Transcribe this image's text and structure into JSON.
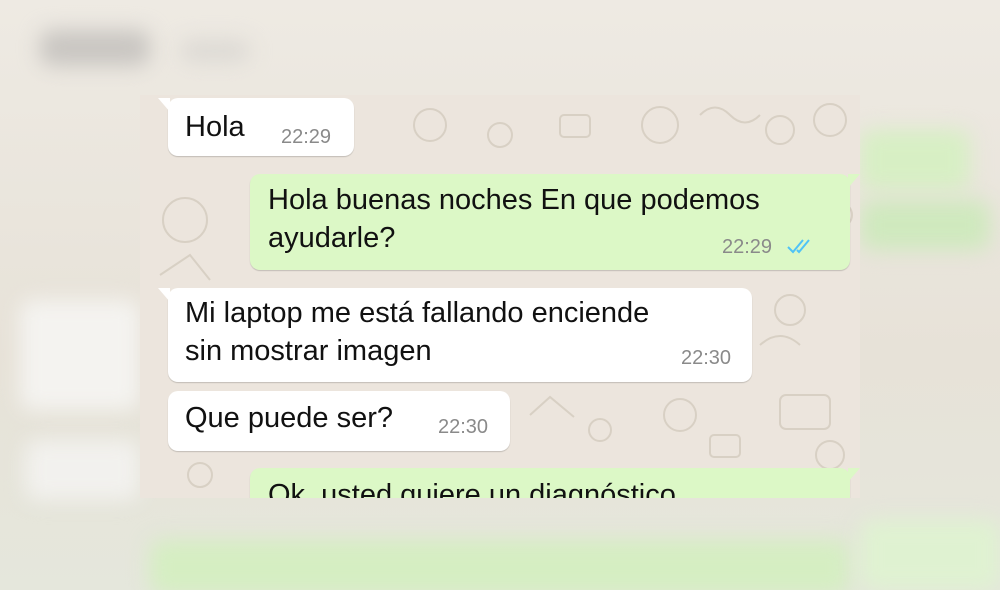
{
  "chat": {
    "messages": [
      {
        "direction": "in",
        "text": "Hola",
        "time": "22:29"
      },
      {
        "direction": "out",
        "text": "Hola buenas noches En que podemos\nayudarle?",
        "time": "22:29",
        "status": "read",
        "status_icon": "double-check-icon"
      },
      {
        "direction": "in",
        "text": "Mi laptop me está fallando enciende\nsin mostrar imagen",
        "time": "22:30"
      },
      {
        "direction": "in",
        "text": "Que puede ser?",
        "time": "22:30"
      },
      {
        "direction": "out",
        "text": "Ok, usted quiere un diagnóstico"
      }
    ]
  },
  "colors": {
    "chat_background": "#ece5dd",
    "incoming_bubble": "#ffffff",
    "outgoing_bubble": "#dcf8c6",
    "read_ticks": "#4fc3f7",
    "timestamp": "#8a8a8a"
  }
}
